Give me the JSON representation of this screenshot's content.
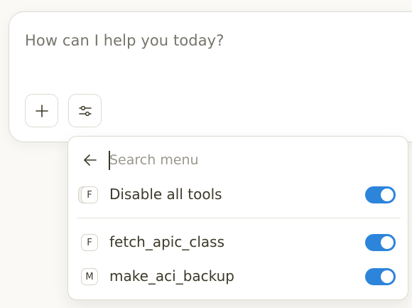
{
  "composer": {
    "placeholder": "How can I help you today?",
    "buttons": [
      {
        "name": "add-button",
        "icon": "plus-icon"
      },
      {
        "name": "tools-settings-button",
        "icon": "sliders-icon"
      }
    ]
  },
  "menu": {
    "search": {
      "placeholder": "Search menu",
      "value": ""
    },
    "back_icon": "arrow-left-icon",
    "disable_all": {
      "badge": "F",
      "label": "Disable all tools",
      "enabled": true
    },
    "tools": [
      {
        "badge": "F",
        "label": "fetch_apic_class",
        "enabled": true
      },
      {
        "badge": "M",
        "label": "make_aci_backup",
        "enabled": true
      }
    ]
  },
  "colors": {
    "background": "#faf9f5",
    "toggle_on": "#2c84db",
    "text": "#3d3929",
    "placeholder": "#76746b"
  }
}
